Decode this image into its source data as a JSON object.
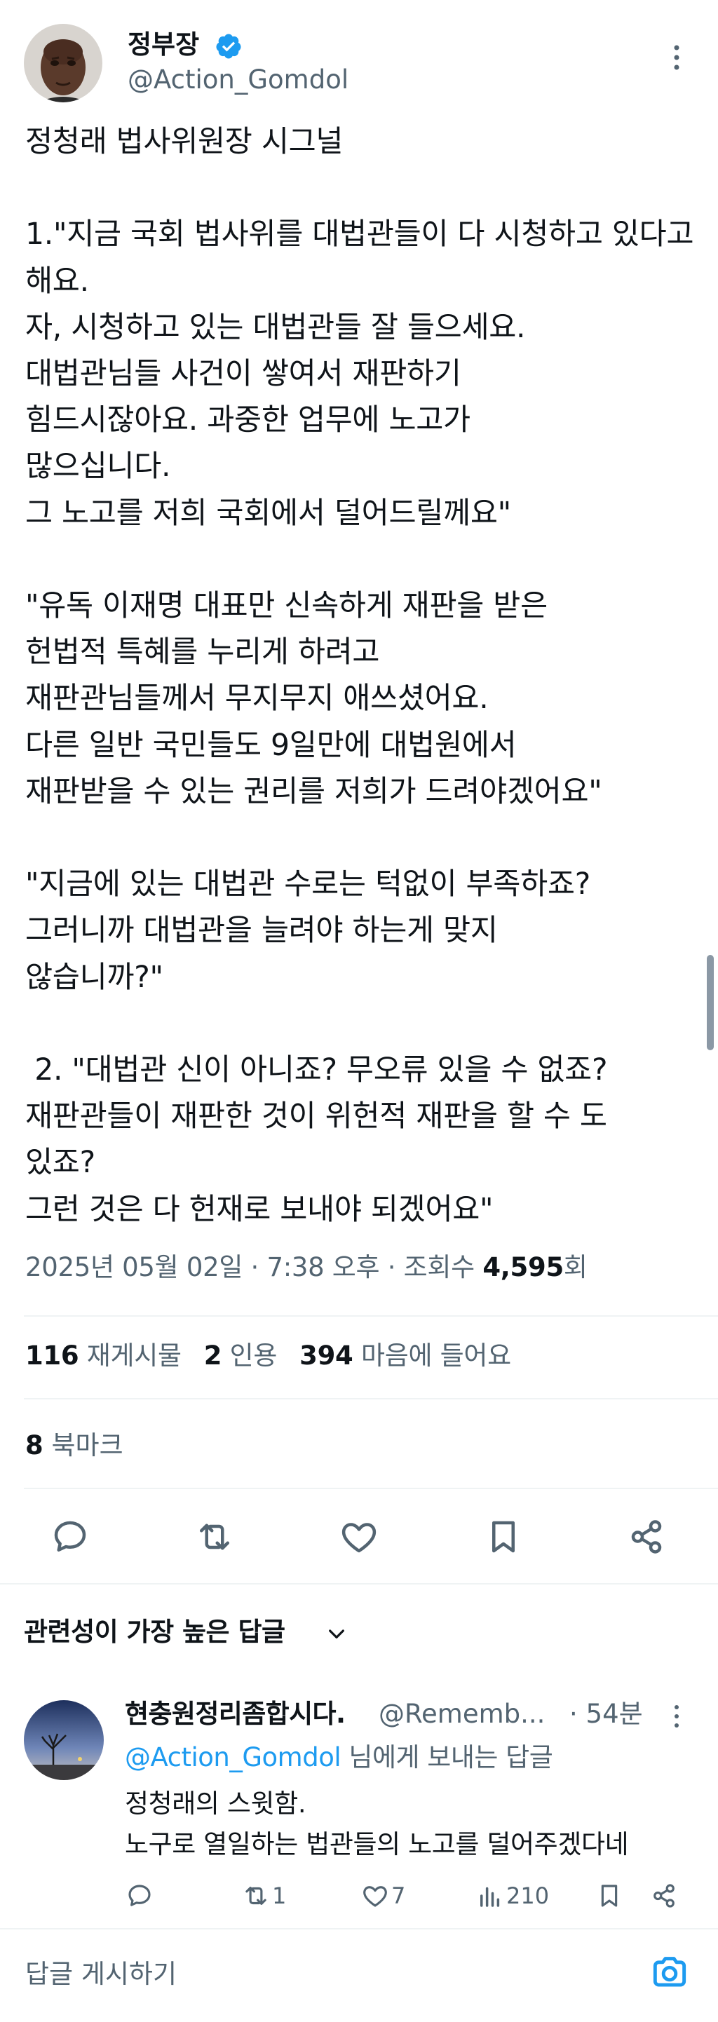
{
  "post": {
    "author_name": "정부장",
    "author_handle": "@Action_Gomdol",
    "verified": true,
    "text": "정청래 법사위원장 시그널\n\n1.\"지금 국회 법사위를 대법관들이 다 시청하고 있다고 해요.\n자, 시청하고 있는 대법관들 잘 들으세요.\n대법관님들 사건이 쌓여서 재판하기\n힘드시잖아요. 과중한 업무에 노고가\n많으십니다.\n그 노고를 저희 국회에서 덜어드릴께요\"\n\n\"유독 이재명 대표만 신속하게 재판을 받은\n헌법적 특혜를 누리게 하려고\n재판관님들께서 무지무지 애쓰셨어요.\n다른 일반 국민들도 9일만에 대법원에서\n재판받을 수 있는 권리를 저희가 드려야겠어요\"\n\n\"지금에 있는 대법관 수로는 턱없이 부족하죠?\n그러니까 대법관을 늘려야 하는게 맞지\n않습니까?\"\n\n 2. \"대법관 신이 아니죠? 무오류 있을 수 없죠?\n재판관들이 재판한 것이 위헌적 재판을 할 수 도\n있죠?\n그런 것은 다 헌재로 보내야 되겠어요\"",
    "timestamp": "2025년 05월 02일 · 7:38 오후 · 조회수 ",
    "views": "4,595",
    "views_suffix": "회"
  },
  "stats": {
    "reposts_count": "116",
    "reposts_label": " 재게시물",
    "quotes_count": "2",
    "quotes_label": " 인용",
    "likes_count": "394",
    "likes_label": " 마음에 들어요",
    "bookmarks_count": "8",
    "bookmarks_label": " 북마크"
  },
  "replies_section": {
    "sort_label": "관련성이 가장 높은 답글"
  },
  "reply": {
    "author_name": "현충원정리좀합시다.",
    "author_handle": "@Rememb...",
    "time": "· 54분",
    "reply_prefix": "@Action_Gomdol",
    "reply_suffix": " 님에게 보내는 답글",
    "text": "정청래의 스윗함.\n노구로 열일하는 법관들의 노고를 덜어주겠다네",
    "retweets": "1",
    "likes": "7",
    "views": "210"
  },
  "composer": {
    "placeholder": "답글 게시하기"
  },
  "icons": {
    "verified": "verified-badge-icon",
    "more": "more-vertical-icon",
    "reply": "reply-icon",
    "repost": "repost-icon",
    "like": "heart-icon",
    "bookmark": "bookmark-icon",
    "share": "share-icon",
    "views": "views-icon",
    "chevron": "chevron-down-icon",
    "camera": "camera-icon"
  },
  "colors": {
    "accent": "#1d9bf0",
    "text": "#0f1419",
    "secondary": "#536471",
    "divider": "#eff3f4"
  }
}
